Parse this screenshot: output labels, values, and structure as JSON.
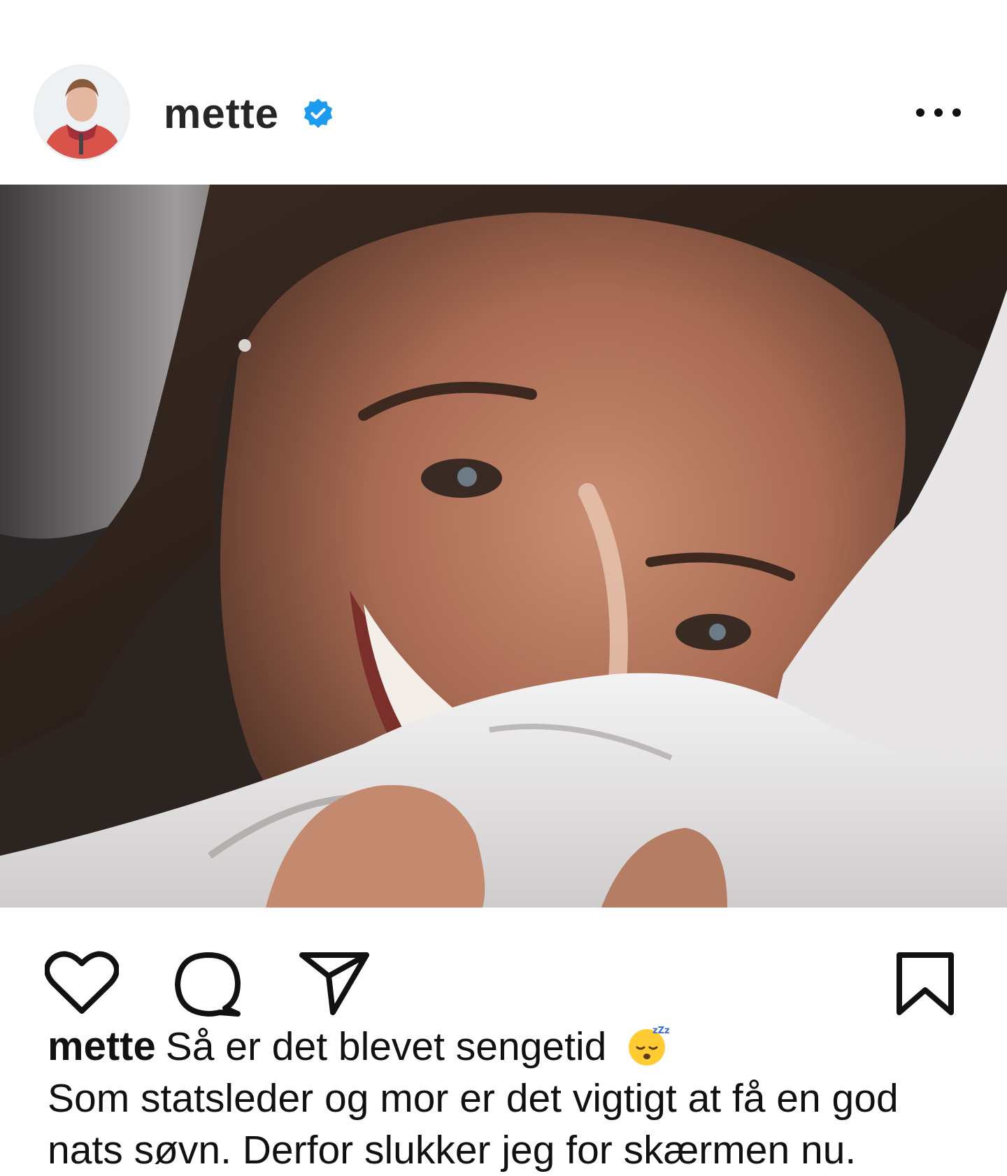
{
  "header": {
    "username": "mette",
    "avatar_icon": "profile-photo-icon",
    "verified_icon": "verified-badge-icon",
    "more_icon": "more-options-icon"
  },
  "post": {
    "image_icon": "post-photo",
    "actions": {
      "like_icon": "heart-icon",
      "comment_icon": "comment-bubble-icon",
      "share_icon": "send-icon",
      "save_icon": "bookmark-icon"
    },
    "caption": {
      "author": "mette",
      "first_line": "Så er det blevet sengetid",
      "emoji_icon": "sleeping-face-emoji",
      "line2": "Som statsleder og mor er det vigtigt at få en god",
      "line3": "nats søvn. Derfor slukker jeg for skærmen nu."
    }
  },
  "colors": {
    "verified_blue": "#1d9bf0",
    "text": "#111111",
    "username": "#262626"
  }
}
